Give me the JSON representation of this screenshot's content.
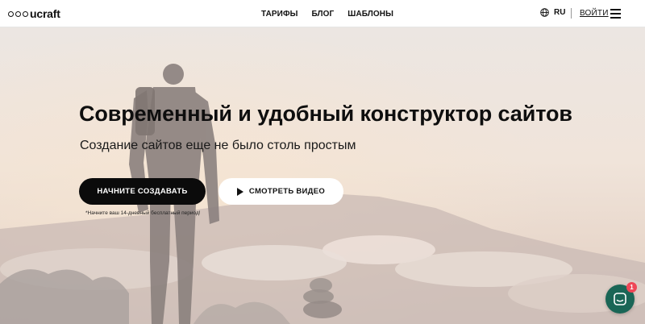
{
  "header": {
    "logo_text": "ucraft",
    "nav": [
      {
        "label": "ТАРИФЫ"
      },
      {
        "label": "БЛОГ"
      },
      {
        "label": "ШАБЛОНЫ"
      }
    ],
    "language": "RU",
    "login_label": "ВОЙТИ"
  },
  "hero": {
    "title": "Современный и удобный конструктор сайтов",
    "subtitle": "Создание сайтов еще не было столь простым",
    "primary_button": "НАЧНИТЕ СОЗДАВАТЬ",
    "secondary_button": "СМОТРЕТЬ ВИДЕО",
    "trial_note": "*Начните ваш 14-дневный бесплатный период!"
  },
  "chat": {
    "badge_count": "1",
    "accent_color": "#1a6656",
    "badge_color": "#ee4756"
  },
  "icons": {
    "globe": "globe-icon",
    "menu": "hamburger-menu-icon",
    "play": "play-icon",
    "chat": "chat-icon"
  }
}
